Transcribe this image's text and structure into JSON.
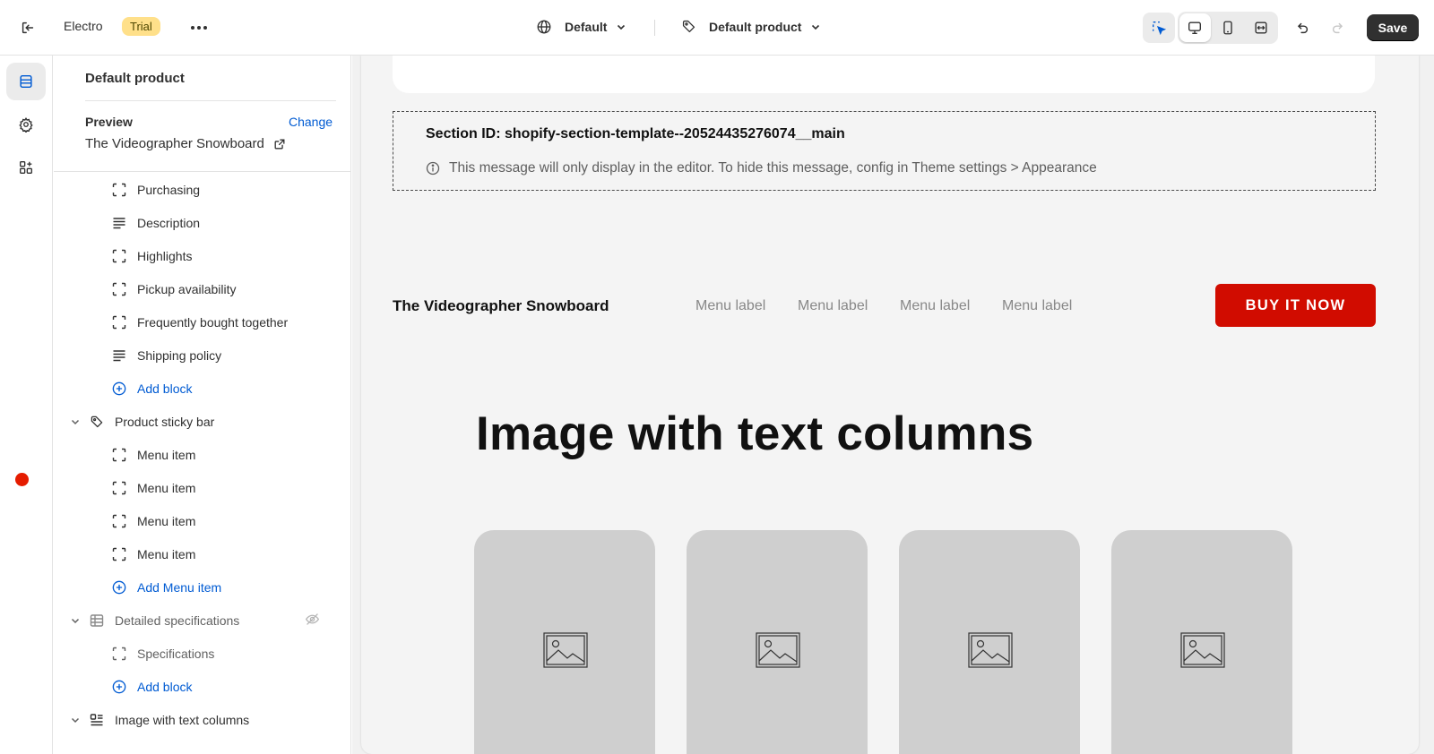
{
  "topbar": {
    "store_name": "Electro",
    "badge": "Trial",
    "language_select": "Default",
    "template_select": "Default product",
    "save_label": "Save"
  },
  "sidebar": {
    "title": "Default product",
    "preview_label": "Preview",
    "change_label": "Change",
    "preview_value": "The Videographer Snowboard",
    "tree": {
      "main_children": [
        "Purchasing",
        "Description",
        "Highlights",
        "Pickup availability",
        "Frequently bought together",
        "Shipping policy"
      ],
      "main_add": "Add block",
      "sticky_section": "Product sticky bar",
      "sticky_children": [
        "Menu item",
        "Menu item",
        "Menu item",
        "Menu item"
      ],
      "sticky_add": "Add Menu item",
      "specs_section": "Detailed specifications",
      "specs_children": [
        "Specifications"
      ],
      "specs_add": "Add block",
      "columns_section": "Image with text columns"
    }
  },
  "preview": {
    "notice_title": "Section ID: shopify-section-template--20524435276074__main",
    "notice_message": "This message will only display in the editor. To hide this message, config in Theme settings > Appearance",
    "sticky_product_title": "The Videographer Snowboard",
    "menu_labels": [
      "Menu label",
      "Menu label",
      "Menu label",
      "Menu label"
    ],
    "buy_button": "BUY IT NOW",
    "heading": "Image with text columns"
  },
  "colors": {
    "accent_blue": "#005bd3",
    "buy_button_red": "#d10c00",
    "trial_badge": "#ffe08a",
    "status_dot": "#e51c00"
  }
}
